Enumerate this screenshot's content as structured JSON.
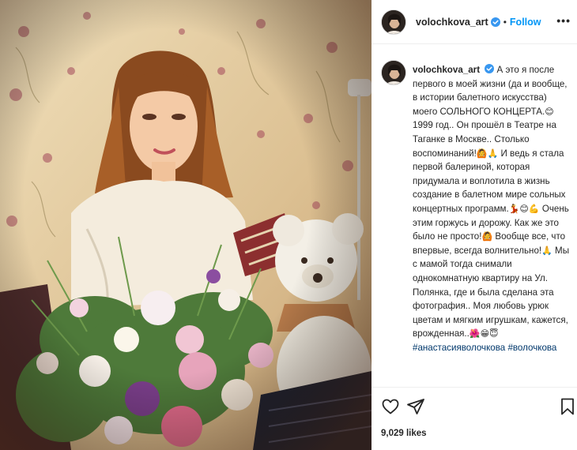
{
  "post": {
    "username": "volochkova_art",
    "follow_label": "Follow",
    "dot": "•",
    "more_label": "•••"
  },
  "caption": {
    "username": "volochkova_art",
    "parts": {
      "p1": "А это я после первого в моей жизни (да и вообще, в истории балетного искусства) моего СОЛЬНОГО КОНЦЕРТА.",
      "e1": "😊",
      "p2": " 1999 год.. Он прошёл в Театре на Таганке в Москве.. Столько воспоминаний!",
      "e2": "🙆🙏",
      "p3": " И ведь я стала первой балериной, которая придумала и воплотила в жизнь создание в балетном мире сольных концертных программ.",
      "e3": "💃😊💪",
      "p4": " Очень этим горжусь и дорожу. Как же это было не просто!",
      "e4": "🙆",
      "p5": " Вообще все, что впервые, всегда волнительно!",
      "e5": "🙏",
      "p6": " Мы с мамой тогда снимали однокомнатную квартиру на Ул. Полянка, где и была сделана эта фотография.. Моя любовь урюк цветам и мягким игрушкам, кажется, врожденная..",
      "e6": "🌺😁😇"
    },
    "hashtags": [
      "#анастасияволочкова",
      "#волочкова"
    ]
  },
  "likes_text": "9,029 likes",
  "icons": {
    "heart": "heart-icon",
    "share": "paper-plane-icon",
    "save": "bookmark-icon",
    "verified": "verified-badge-icon"
  },
  "colors": {
    "follow": "#0095f6",
    "verified": "#3897f0",
    "hashtag": "#00376b"
  }
}
